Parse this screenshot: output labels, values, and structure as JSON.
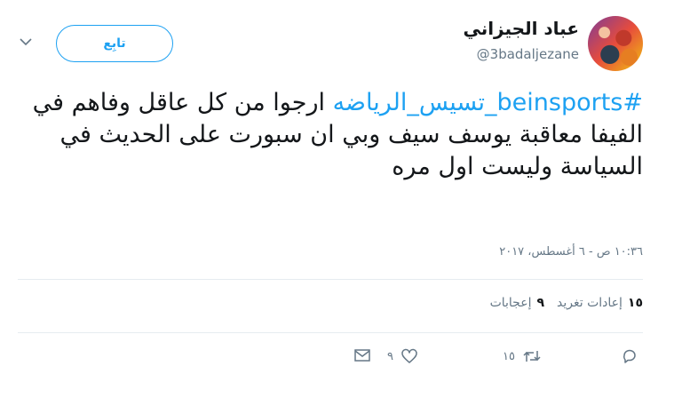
{
  "user": {
    "display_name": "عباد الجيزاني",
    "screen_name": "@3badaljezane"
  },
  "follow_label": "تابِع",
  "tweet": {
    "hashtag": "#beinsports_تسيس_الرياضه",
    "text": " ارجوا من كل عاقل وفاهم في الفيفا معاقبة يوسف سيف وبي ان سبورت على الحديث في السياسة وليست اول مره"
  },
  "timestamp": "١٠:٣٦ ص - ٦ أغسطس، ٢٠١٧",
  "stats": {
    "retweets_count": "١٥",
    "retweets_label": "إعادات تغريد",
    "likes_count": "٩",
    "likes_label": "إعجابات"
  },
  "actions": {
    "retweet_count": "١٥",
    "like_count": "٩"
  },
  "colors": {
    "accent": "#1da1f2",
    "secondary_text": "#657786",
    "divider": "#e6ecf0"
  },
  "icons": [
    "caret-down-icon",
    "reply-icon",
    "retweet-icon",
    "heart-icon",
    "envelope-icon"
  ]
}
